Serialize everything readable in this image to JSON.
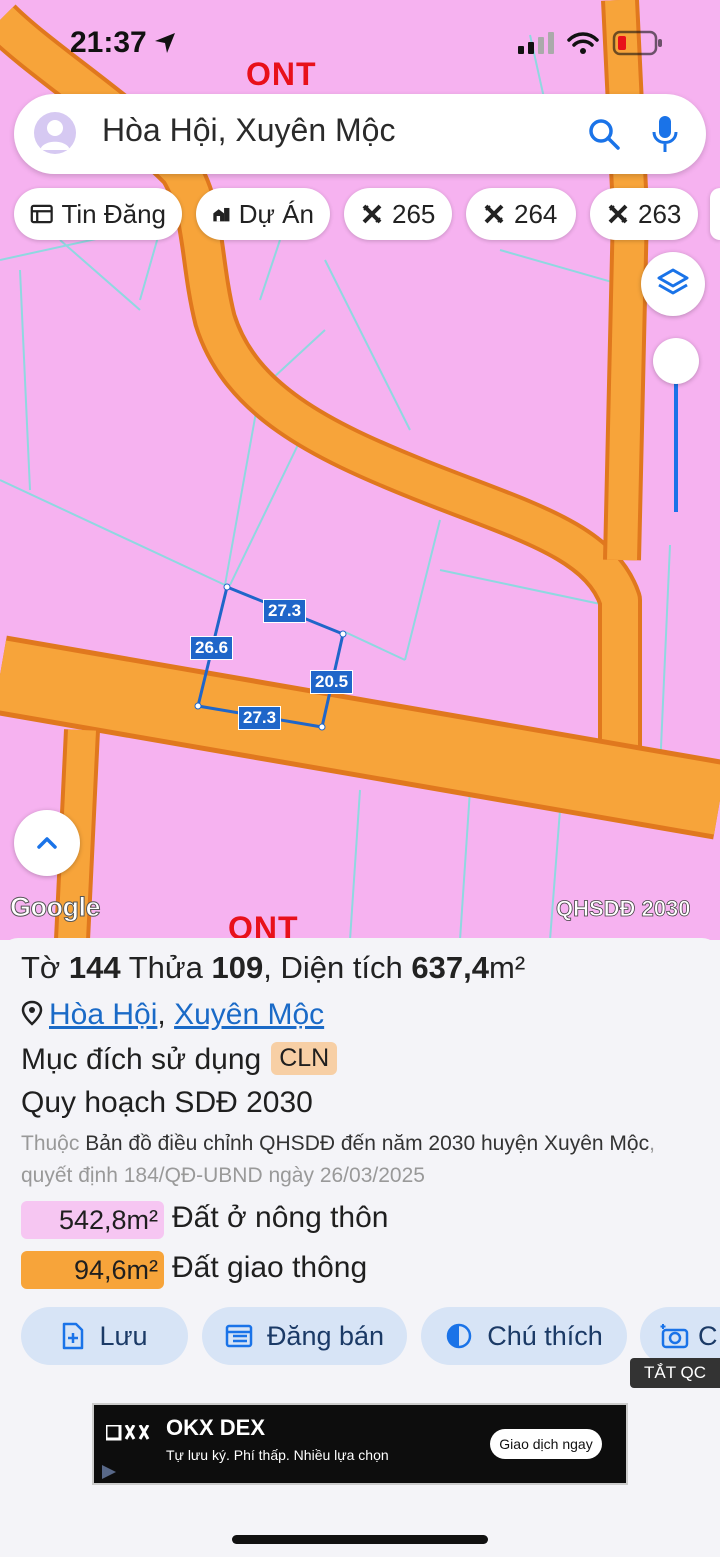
{
  "status": {
    "time": "21:37"
  },
  "map": {
    "zone_top": "ONT",
    "zone_bottom": "ONT",
    "google_logo": "Google",
    "layer_name": "QHSDĐ 2030",
    "dimensions": {
      "top": "27.3",
      "left": "26.6",
      "right": "20.5",
      "bottom": "27.3"
    }
  },
  "search": {
    "text": "Hòa Hội, Xuyên Mộc"
  },
  "chips": [
    {
      "label": "Tin Đăng",
      "icon": "news-icon"
    },
    {
      "label": "Dự Án",
      "icon": "building-icon"
    },
    {
      "label": "265",
      "icon": "map-tile-icon"
    },
    {
      "label": "264",
      "icon": "map-tile-icon"
    },
    {
      "label": "263",
      "icon": "map-tile-icon"
    }
  ],
  "parcel": {
    "to_label": "Tờ",
    "to": "144",
    "thua_label": "Thửa",
    "thua": "109",
    "area_label": "Diện tích",
    "area": "637,4",
    "unit": "m²",
    "commune": "Hòa Hội",
    "district": "Xuyên Mộc",
    "purpose_label": "Mục đích sử dụng",
    "purpose_code": "CLN",
    "plan_title": "Quy hoạch SDĐ 2030",
    "belongs_prefix": "Thuộc",
    "belongs_text": "Bản đồ điều chỉnh QHSDĐ đến năm 2030 huyện Xuyên Mộc",
    "decision_text": ", quyết định 184/QĐ-UBND ngày 26/03/2025",
    "zones": [
      {
        "value": "542,8m²",
        "label": "Đất ở nông thôn",
        "color": "#f6c6f2"
      },
      {
        "value": "94,6m²",
        "label": "Đất giao thông",
        "color": "#f7a43a"
      }
    ]
  },
  "actions": [
    {
      "label": "Lưu",
      "icon": "save-icon"
    },
    {
      "label": "Đăng bán",
      "icon": "post-icon"
    },
    {
      "label": "Chú thích",
      "icon": "legend-icon"
    },
    {
      "label": "C",
      "icon": "camera-icon"
    }
  ],
  "ad": {
    "hide_label": "TẮT QC",
    "brand": "OKX DEX",
    "tagline": "Tự lưu ký. Phí thấp. Nhiều lựa chọn",
    "cta": "Giao dịch ngay"
  },
  "colors": {
    "land": "#f6b2f0",
    "road": "#f7a43a",
    "accent": "#1a73e8",
    "dimension": "#1f66c9"
  }
}
